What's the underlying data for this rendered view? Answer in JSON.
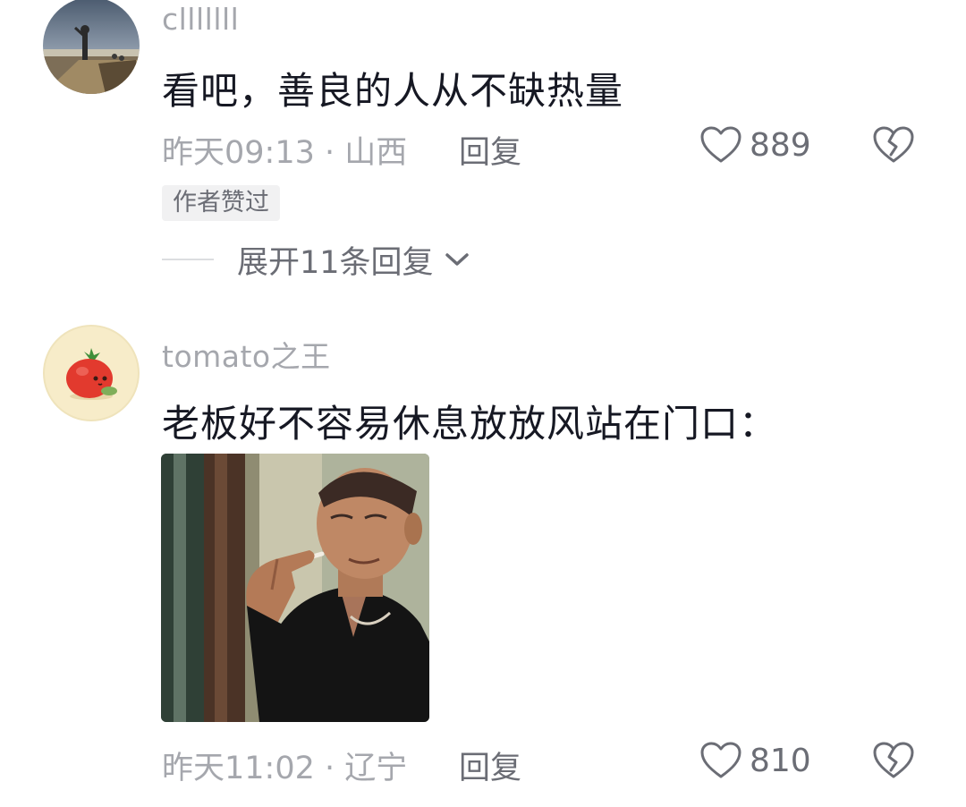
{
  "comments": [
    {
      "username": "clllllll",
      "text": "看吧，善良的人从不缺热量",
      "time_location": "昨天09:13 · 山西",
      "reply_label": "回复",
      "like_count": "889",
      "badge": "作者赞过",
      "expand_replies": "展开11条回复"
    },
    {
      "username": "tomato之王",
      "text": "老板好不容易休息放放风站在门口：",
      "time_location": "昨天11:02 · 辽宁",
      "reply_label": "回复",
      "like_count": "810"
    }
  ],
  "icons": {
    "like": "heart-outline-icon",
    "dislike": "broken-heart-icon",
    "expand": "chevron-down-icon"
  },
  "colors": {
    "secondary_text": "#a5a7ad",
    "action_text": "#6b6d75",
    "primary_text": "#161823",
    "badge_bg": "#f1f1f2"
  }
}
